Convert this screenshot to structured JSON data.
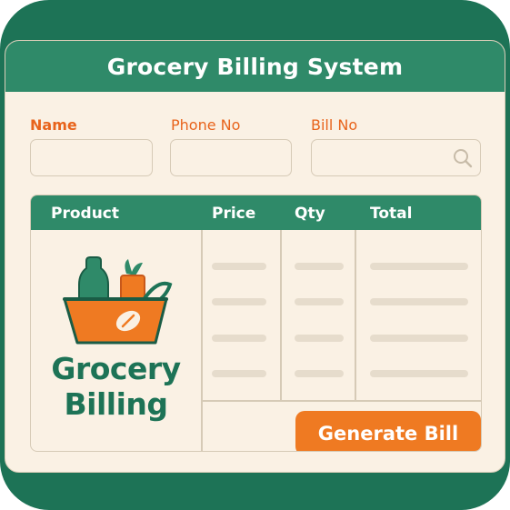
{
  "app": {
    "title": "Grocery Billing System"
  },
  "form": {
    "name_label": "Name",
    "name_value": "",
    "phone_label": "Phone No",
    "phone_value": "",
    "bill_label": "Bill No",
    "bill_value": ""
  },
  "table": {
    "columns": [
      "Product",
      "Price",
      "Qty",
      "Total"
    ],
    "row_count": 4
  },
  "logo": {
    "line1": "Grocery",
    "line2": "Billing"
  },
  "actions": {
    "generate_label": "Generate Bill"
  },
  "icons": {
    "search": "search-icon",
    "logo": "grocery-basket-icon"
  },
  "colors": {
    "brand_green": "#2f8a69",
    "frame_green": "#1d7356",
    "accent_orange": "#ef7a22",
    "background": "#faf1e4"
  }
}
